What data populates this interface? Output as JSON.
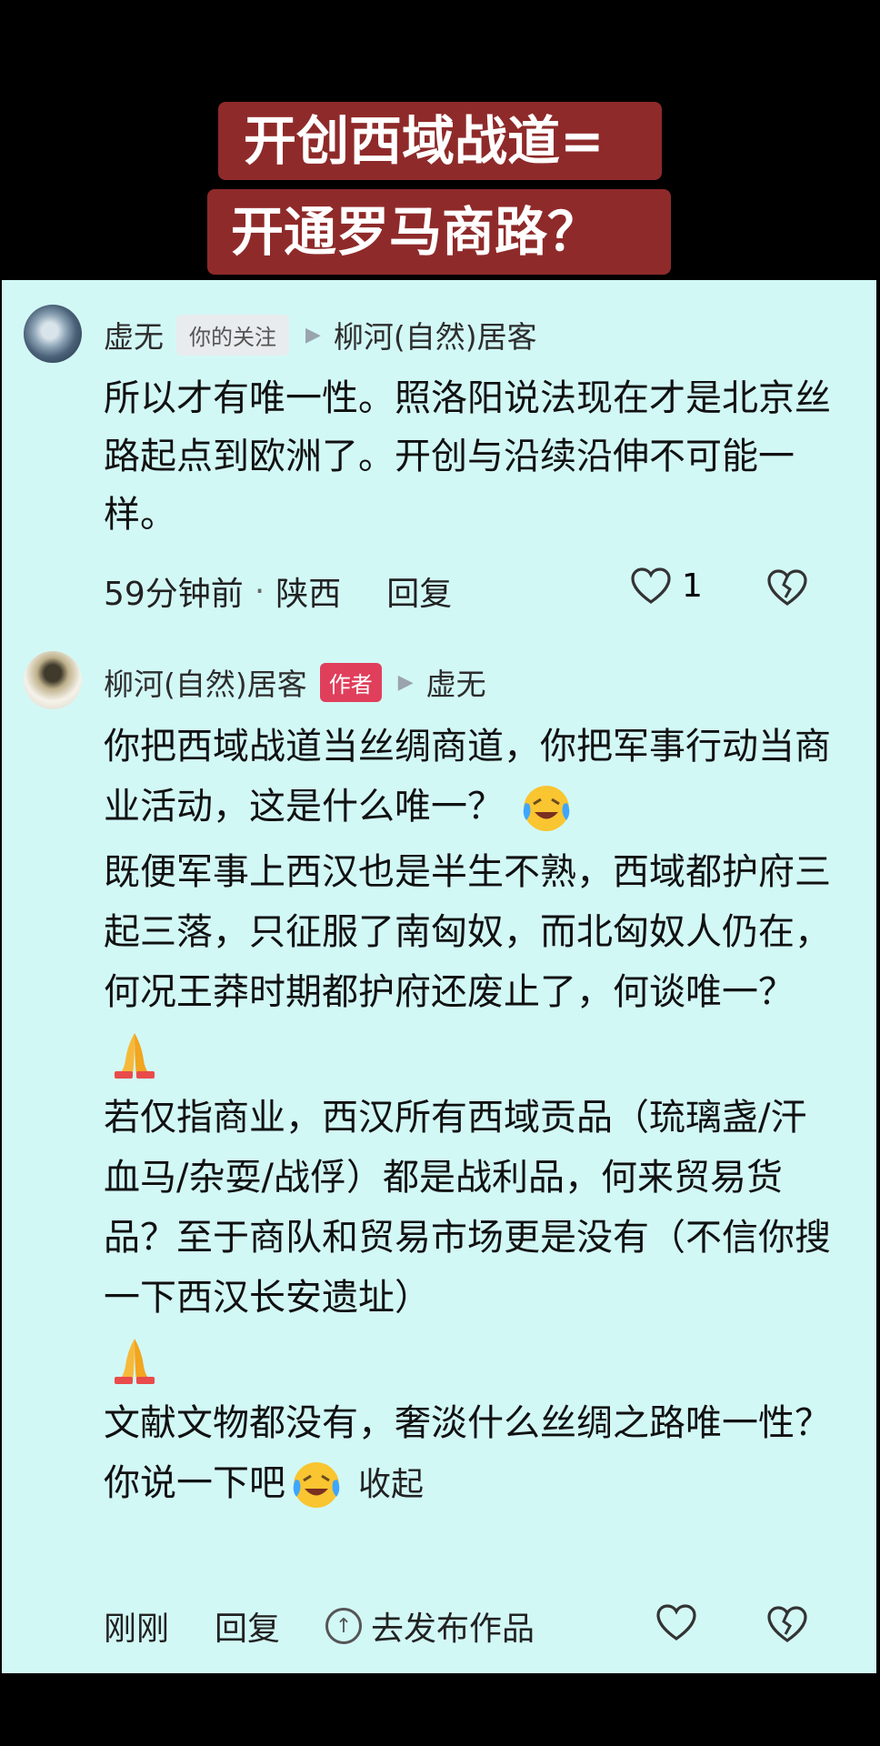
{
  "title": {
    "line1": "开创西域战道=",
    "line2": "开通罗马商路？"
  },
  "comments": [
    {
      "user": "虚无",
      "tag": "你的关注",
      "reply_to": "柳河(自然)居客",
      "text": "所以才有唯一性。照洛阳说法现在才是北京丝路起点到欧洲了。开创与沿续沿伸不可能一样。",
      "time": "59分钟前",
      "separator": "·",
      "location": "陕西",
      "reply_label": "回复",
      "likes": "1"
    },
    {
      "user": "柳河(自然)居客",
      "tag": "作者",
      "reply_to": "虚无",
      "paras": [
        "你把西域战道当丝绸商道，你把军事行动当商业活动，这是什么唯一？",
        "既便军事上西汉也是半生不熟，西域都护府三起三落，只征服了南匈奴，而北匈奴人仍在，何况王莽时期都护府还废止了，何谈唯一？",
        "若仅指商业，西汉所有西域贡品（琉璃盏/汗血马/杂耍/战俘）都是战利品，何来贸易货品？至于商队和贸易市场更是没有（不信你搜一下西汉长安遗址）",
        "文献文物都没有，奢淡什么丝绸之路唯一性？你说一下吧"
      ],
      "collapse_label": "收起",
      "time": "刚刚",
      "reply_label": "回复",
      "publish_label": "去发布作品"
    }
  ],
  "colors": {
    "title_bg": "#8f2a2a",
    "panel_bg": "#d2f8f6",
    "author_tag": "#e03f5c"
  },
  "icons": [
    "arrow-icon",
    "heart-icon",
    "broken-heart-icon",
    "crying-laughing-emoji",
    "praying-hands-emoji",
    "up-arrow-circle-icon"
  ]
}
